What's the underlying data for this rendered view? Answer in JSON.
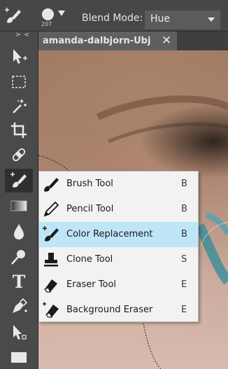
{
  "options_bar": {
    "brush_size": "207",
    "blend_mode_label": "Blend Mode:",
    "blend_mode_value": "Hue"
  },
  "toolbar": {
    "collapse_label": "> <",
    "text_tool_letter": "T"
  },
  "document_tab": {
    "title": "amanda-dalbjorn-Ubj",
    "close": "✕"
  },
  "tool_menu": {
    "items": [
      {
        "icon": "brush-icon",
        "label": "Brush Tool",
        "shortcut": "B"
      },
      {
        "icon": "pencil-icon",
        "label": "Pencil Tool",
        "shortcut": "B"
      },
      {
        "icon": "color-replacement-icon",
        "label": "Color Replacement",
        "shortcut": "B"
      },
      {
        "icon": "clone-stamp-icon",
        "label": "Clone Tool",
        "shortcut": "S"
      },
      {
        "icon": "eraser-icon",
        "label": "Eraser Tool",
        "shortcut": "E"
      },
      {
        "icon": "background-eraser-icon",
        "label": "Background Eraser",
        "shortcut": "E"
      }
    ],
    "highlighted_index": 2
  },
  "colors": {
    "menu_highlight": "#bee6f6",
    "toolbar_bg": "#4a4a4a",
    "options_bg": "#474747"
  }
}
